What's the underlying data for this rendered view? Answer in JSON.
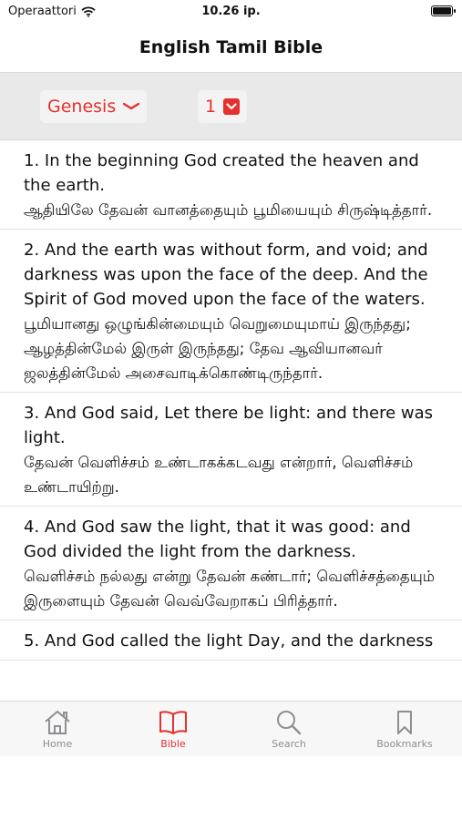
{
  "status": {
    "carrier": "Operaattori",
    "time": "10.26 ip."
  },
  "nav": {
    "title": "English Tamil Bible"
  },
  "picker": {
    "book": "Genesis",
    "chapter": "1"
  },
  "verses": [
    {
      "en": "1. In the beginning God created the heaven and the earth.",
      "ta": "ஆதியிலே தேவன் வானத்தையும் பூமியையும் சிருஷ்டித்தார்."
    },
    {
      "en": "2. And the earth was without form, and void; and darkness was upon the face of the deep. And the Spirit of God moved upon the face of the waters.",
      "ta": "பூமியானது ஒழுங்கின்மையும் வெறுமையுமாய் இருந்தது; ஆழத்தின்மேல் இருள் இருந்தது; தேவ ஆவியானவர் ஜலத்தின்மேல் அசைவாடிக்கொண்டிருந்தார்."
    },
    {
      "en": "3. And God said, Let there be light: and there was light.",
      "ta": "தேவன் வெளிச்சம் உண்டாகக்கடவது என்றார், வெளிச்சம் உண்டாயிற்று."
    },
    {
      "en": "4. And God saw the light, that it was good: and God divided the light from the darkness.",
      "ta": "வெளிச்சம் நல்லது என்று தேவன் கண்டார்; வெளிச்சத்தையும் இருளையும் தேவன் வெவ்வேறாகப் பிரித்தார்."
    },
    {
      "en": "5. And God called the light Day, and the darkness",
      "ta": ""
    }
  ],
  "tabs": [
    {
      "label": "Home",
      "icon": "home-icon"
    },
    {
      "label": "Bible",
      "icon": "book-icon"
    },
    {
      "label": "Search",
      "icon": "search-icon"
    },
    {
      "label": "Bookmarks",
      "icon": "bookmark-icon"
    }
  ],
  "active_tab": "Bible",
  "colors": {
    "accent": "#e5302f",
    "inactive": "#8e8e93",
    "picker_bar": "#e9e9e9"
  }
}
